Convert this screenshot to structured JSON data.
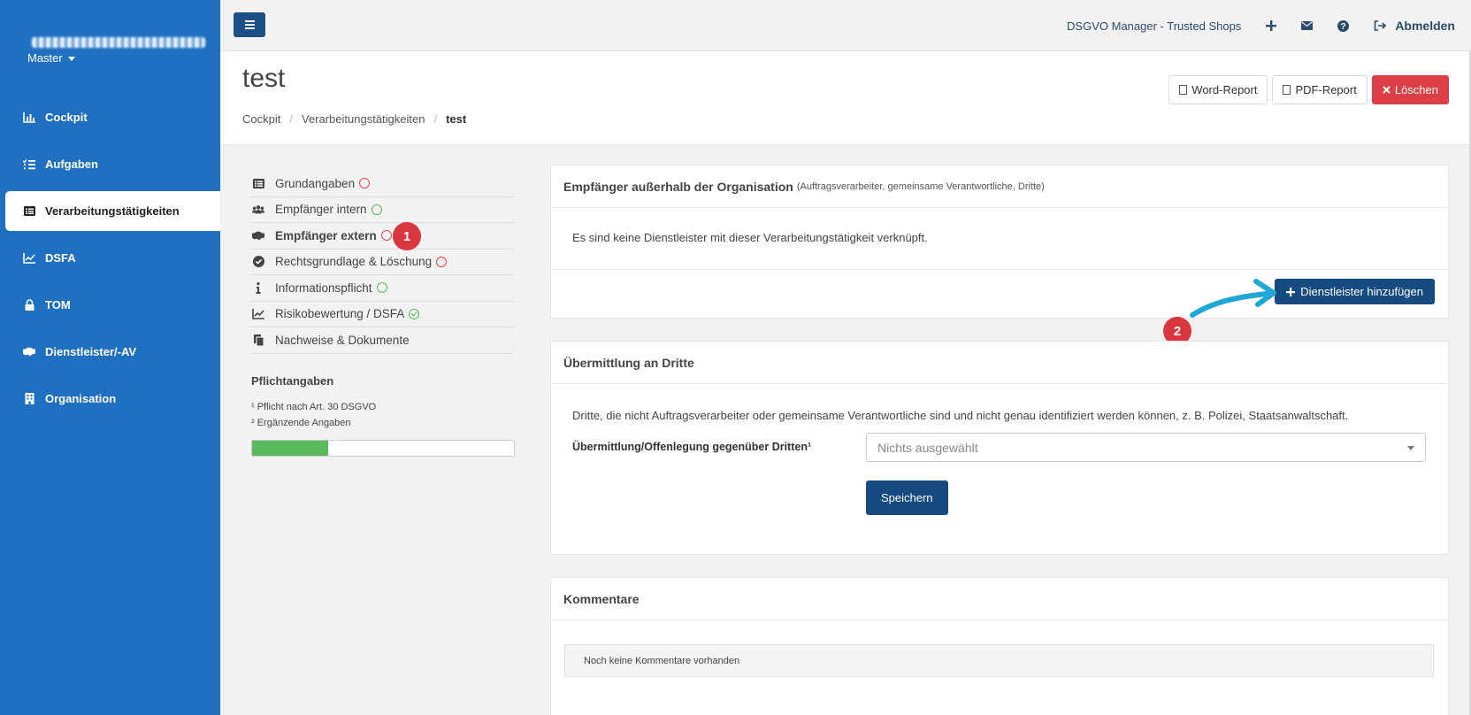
{
  "sidebar": {
    "user_name": "max@muster-beispiel.de",
    "tenant": "Master",
    "items": [
      {
        "label": "Cockpit",
        "icon": "chart-bar-icon",
        "active": false
      },
      {
        "label": "Aufgaben",
        "icon": "tasks-icon",
        "active": false
      },
      {
        "label": "Verarbeitungstätigkeiten",
        "icon": "list-alt-icon",
        "active": true
      },
      {
        "label": "DSFA",
        "icon": "chart-line-icon",
        "active": false
      },
      {
        "label": "TOM",
        "icon": "lock-icon",
        "active": false
      },
      {
        "label": "Dienstleister/-AV",
        "icon": "handshake-icon",
        "active": false
      },
      {
        "label": "Organisation",
        "icon": "building-icon",
        "active": false
      }
    ]
  },
  "topbar": {
    "app_name": "DSGVO Manager - Trusted Shops",
    "logout": "Abmelden"
  },
  "header": {
    "title": "test",
    "breadcrumb": [
      "Cockpit",
      "Verarbeitungstätigkeiten",
      "test"
    ],
    "buttons": {
      "word": "Word-Report",
      "pdf": "PDF-Report",
      "delete": "Löschen"
    }
  },
  "steps": [
    {
      "label": "Grundangaben",
      "icon": "list-icon",
      "status": "incomplete"
    },
    {
      "label": "Empfänger intern",
      "icon": "users-icon",
      "status": "complete"
    },
    {
      "label": "Empfänger extern",
      "icon": "handshake-icon",
      "status": "incomplete",
      "current": true
    },
    {
      "label": "Rechtsgrundlage & Löschung",
      "icon": "check-circle-icon",
      "status": "incomplete"
    },
    {
      "label": "Informationspflicht",
      "icon": "info-icon",
      "status": "complete"
    },
    {
      "label": "Risikobewertung / DSFA",
      "icon": "chart-line-icon",
      "status": "done"
    },
    {
      "label": "Nachweise & Dokumente",
      "icon": "copy-icon",
      "status": "none"
    }
  ],
  "requirements": {
    "title": "Pflichtangaben",
    "footnote1": "¹ Pflicht nach Art. 30 DSGVO",
    "footnote2": "² Ergänzende Angaben",
    "progress": 0.29,
    "progress_color": "#5cb85c"
  },
  "annotations": {
    "badge1": "1",
    "badge2": "2",
    "badge_color": "#d9363e",
    "arrow_color": "#1fa7d6"
  },
  "panel_external": {
    "title": "Empfänger außerhalb der Organisation",
    "subtitle": "(Auftragsverarbeiter, gemeinsame Verantwortliche, Dritte)",
    "empty_text": "Es sind keine Dienstleister mit dieser Verarbeitungstätigkeit verknüpft.",
    "add_button": "Dienstleister hinzufügen"
  },
  "panel_third": {
    "title": "Übermittlung an Dritte",
    "description": "Dritte, die nicht Auftragsverarbeiter oder gemeinsame Verantwortliche sind und nicht genau identifiziert werden können, z. B. Polizei, Staatsanwaltschaft.",
    "field_label": "Übermittlung/Offenlegung gegenüber Dritten¹",
    "select_value": "Nichts ausgewählt",
    "save_button": "Speichern"
  },
  "panel_comments": {
    "title": "Kommentare",
    "empty_text": "Noch keine Kommentare vorhanden"
  },
  "colors": {
    "sidebar": "#2070c2",
    "primary": "#154b80",
    "danger": "#dc3f45",
    "success": "#5cb85c"
  }
}
